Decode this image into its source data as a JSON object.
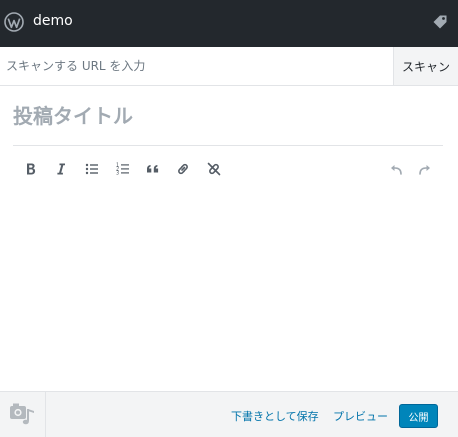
{
  "header": {
    "site_name": "demo",
    "icons": {
      "logo": "wordpress-logo-icon",
      "tag": "tag-icon"
    }
  },
  "scan": {
    "placeholder": "スキャンする URL を入力",
    "button_label": "スキャン"
  },
  "editor": {
    "title_placeholder": "投稿タイトル",
    "toolbar": {
      "left": [
        "bold-icon",
        "italic-icon",
        "bulleted-list-icon",
        "numbered-list-icon",
        "quote-icon",
        "link-icon",
        "unlink-icon"
      ],
      "right": [
        "undo-icon",
        "redo-icon"
      ]
    }
  },
  "footer": {
    "media_icon": "media-icon",
    "draft_label": "下書きとして保存",
    "preview_label": "プレビュー",
    "publish_label": "公開"
  },
  "colors": {
    "header_bg": "#23282d",
    "link": "#0073aa",
    "primary_button": "#0085ba",
    "footer_bg": "#f3f4f5",
    "icon": "#555d66",
    "disabled_icon": "#a2aab2"
  }
}
